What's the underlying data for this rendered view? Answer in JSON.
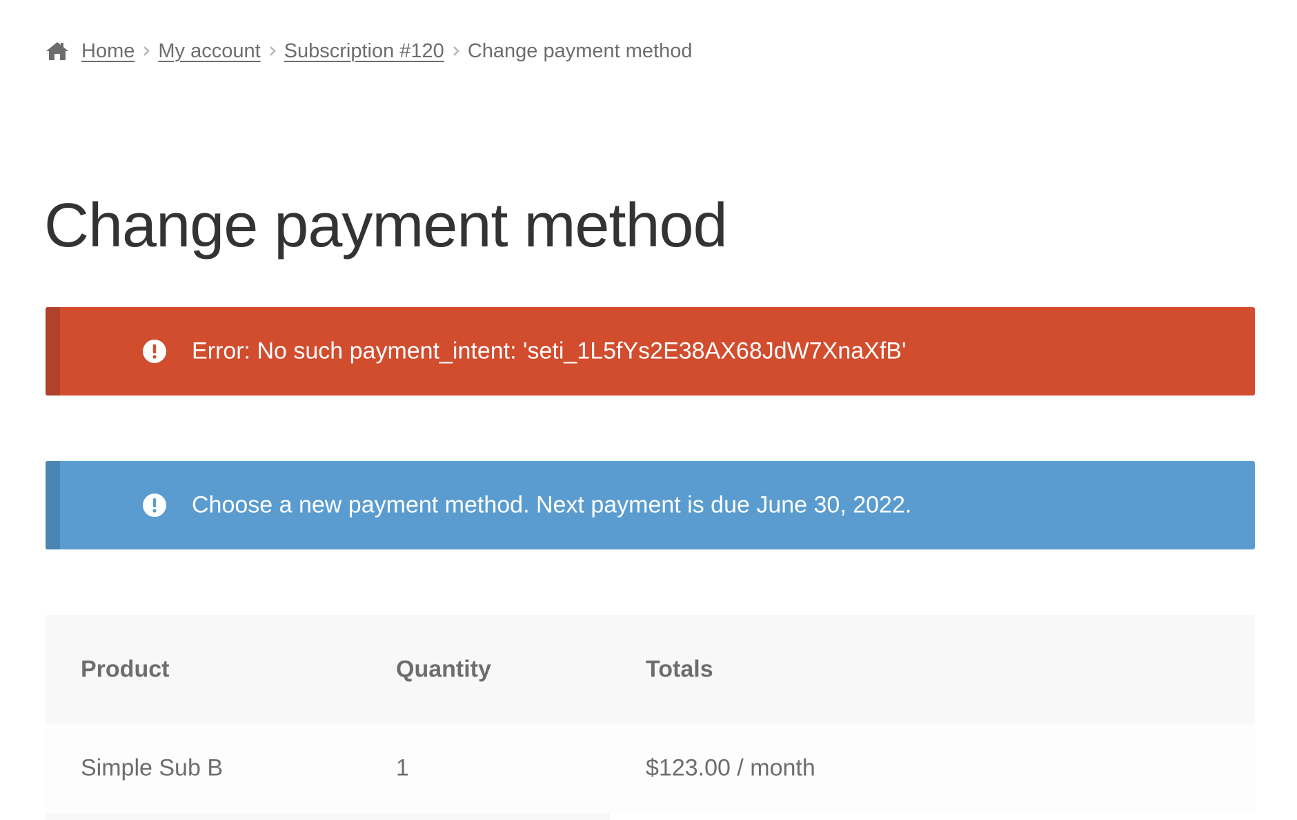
{
  "breadcrumb": {
    "icon": "home-icon",
    "items": [
      {
        "label": "Home"
      },
      {
        "label": "My account"
      },
      {
        "label": "Subscription #120"
      }
    ],
    "current": "Change payment method"
  },
  "page": {
    "title": "Change payment method"
  },
  "notices": {
    "error": {
      "text": "Error: No such payment_intent: 'seti_1L5fYs2E38AX68JdW7XnaXfB'",
      "color": "#d24c2e",
      "icon": "exclamation-circle-icon"
    },
    "info": {
      "text": "Choose a new payment method. Next payment is due June 30, 2022.",
      "color": "#5a9ccf",
      "icon": "exclamation-circle-icon"
    }
  },
  "order_table": {
    "headers": [
      "Product",
      "Quantity",
      "Totals"
    ],
    "rows": [
      {
        "product": "Simple Sub B",
        "quantity": "1",
        "total": "$123.00 / month"
      }
    ]
  }
}
